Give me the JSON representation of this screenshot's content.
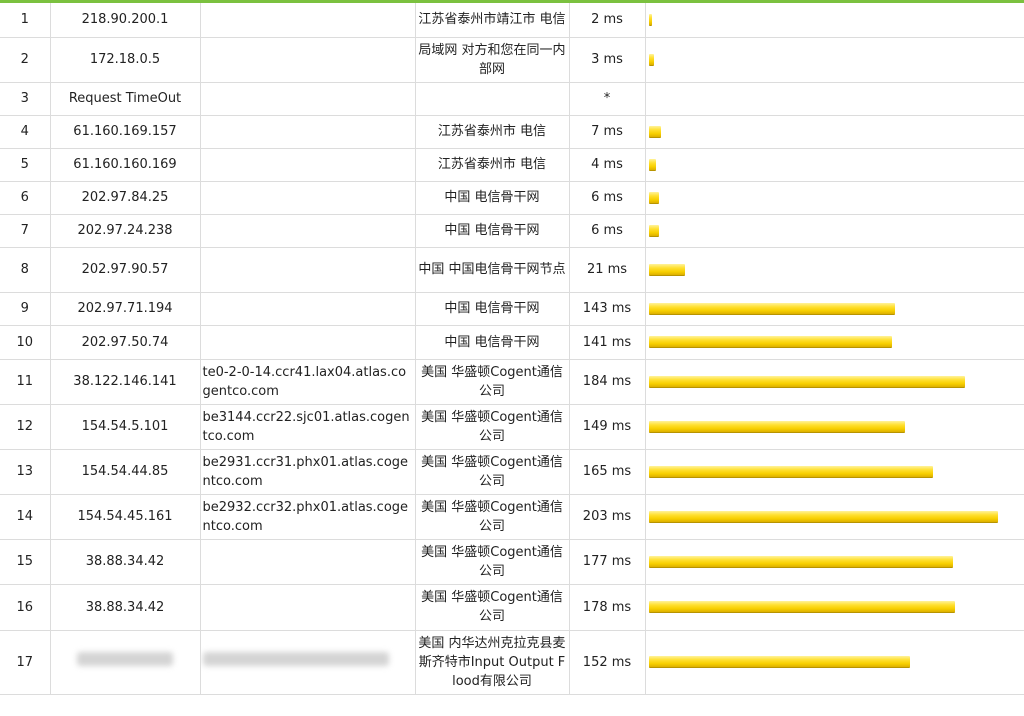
{
  "accent_color": "#7bc13f",
  "bar_color": "#f7cf00",
  "hops": [
    {
      "hop": "1",
      "ip": "218.90.200.1",
      "host": "",
      "location": "江苏省泰州市靖江市 电信",
      "time": "2 ms",
      "ms": 2
    },
    {
      "hop": "2",
      "ip": "172.18.0.5",
      "host": "",
      "location": "局域网 对方和您在同一内部网",
      "time": "3 ms",
      "ms": 3
    },
    {
      "hop": "3",
      "ip": "Request TimeOut",
      "host": "",
      "location": "",
      "time": "*",
      "ms": 0
    },
    {
      "hop": "4",
      "ip": "61.160.169.157",
      "host": "",
      "location": "江苏省泰州市 电信",
      "time": "7 ms",
      "ms": 7
    },
    {
      "hop": "5",
      "ip": "61.160.160.169",
      "host": "",
      "location": "江苏省泰州市 电信",
      "time": "4 ms",
      "ms": 4
    },
    {
      "hop": "6",
      "ip": "202.97.84.25",
      "host": "",
      "location": "中国 电信骨干网",
      "time": "6 ms",
      "ms": 6
    },
    {
      "hop": "7",
      "ip": "202.97.24.238",
      "host": "",
      "location": "中国 电信骨干网",
      "time": "6 ms",
      "ms": 6
    },
    {
      "hop": "8",
      "ip": "202.97.90.57",
      "host": "",
      "location": "中国 中国电信骨干网节点",
      "time": "21 ms",
      "ms": 21
    },
    {
      "hop": "9",
      "ip": "202.97.71.194",
      "host": "",
      "location": "中国 电信骨干网",
      "time": "143 ms",
      "ms": 143
    },
    {
      "hop": "10",
      "ip": "202.97.50.74",
      "host": "",
      "location": "中国 电信骨干网",
      "time": "141 ms",
      "ms": 141
    },
    {
      "hop": "11",
      "ip": "38.122.146.141",
      "host": "te0-2-0-14.ccr41.lax04.atlas.cogentco.com",
      "location": "美国 华盛顿Cogent通信公司",
      "time": "184 ms",
      "ms": 184
    },
    {
      "hop": "12",
      "ip": "154.54.5.101",
      "host": "be3144.ccr22.sjc01.atlas.cogentco.com",
      "location": "美国 华盛顿Cogent通信公司",
      "time": "149 ms",
      "ms": 149
    },
    {
      "hop": "13",
      "ip": "154.54.44.85",
      "host": "be2931.ccr31.phx01.atlas.cogentco.com",
      "location": "美国 华盛顿Cogent通信公司",
      "time": "165 ms",
      "ms": 165
    },
    {
      "hop": "14",
      "ip": "154.54.45.161",
      "host": "be2932.ccr32.phx01.atlas.cogentco.com",
      "location": "美国 华盛顿Cogent通信公司",
      "time": "203 ms",
      "ms": 203
    },
    {
      "hop": "15",
      "ip": "38.88.34.42",
      "host": "",
      "location": "美国 华盛顿Cogent通信公司",
      "time": "177 ms",
      "ms": 177
    },
    {
      "hop": "16",
      "ip": "38.88.34.42",
      "host": "",
      "location": "美国 华盛顿Cogent通信公司",
      "time": "178 ms",
      "ms": 178
    },
    {
      "hop": "17",
      "ip": "",
      "host": "",
      "location": "美国 内华达州克拉克县麦斯齐特市Input Output Flood有限公司",
      "time": "152 ms",
      "ms": 152,
      "redacted": true
    }
  ]
}
